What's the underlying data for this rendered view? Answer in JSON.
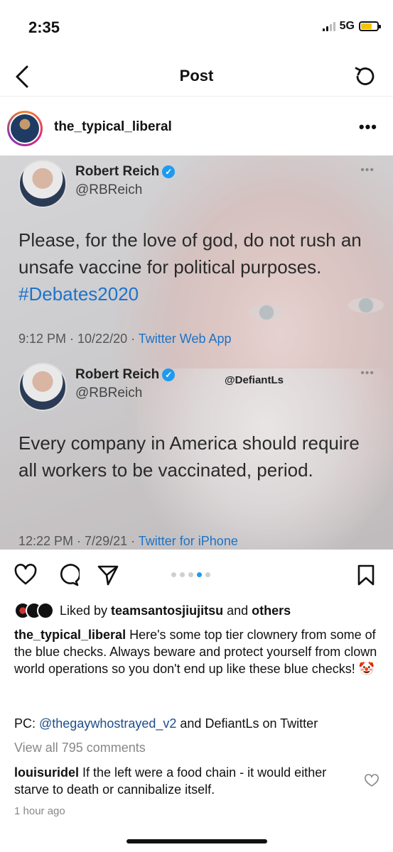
{
  "status": {
    "time": "2:35",
    "network": "5G"
  },
  "nav": {
    "title": "Post"
  },
  "post": {
    "username": "the_typical_liberal",
    "more": "•••"
  },
  "tweets": [
    {
      "name": "Robert Reich",
      "handle": "@RBReich",
      "text_main": "Please, for the love of god, do not rush an unsafe vaccine for political purposes. ",
      "hashtag": "#Debates2020",
      "meta_time": "9:12 PM · 10/22/20 · ",
      "meta_source": "Twitter Web App"
    },
    {
      "name": "Robert Reich",
      "handle": "@RBReich",
      "text_main": "Every company in America  should require all workers to be vaccinated, period.",
      "meta_time": "12:22 PM · 7/29/21 · ",
      "meta_source": "Twitter for iPhone"
    }
  ],
  "watermark": "@DefiantLs",
  "carousel": {
    "count": 5,
    "active_index": 3
  },
  "likes": {
    "prefix": "Liked by ",
    "user": "teamsantosjiujitsu",
    "middle": " and ",
    "others": "others"
  },
  "caption": {
    "username": "the_typical_liberal",
    "text": " Here's some top tier clownery from some of the blue checks. Always beware and protect yourself from clown world operations so you don't end up like these blue checks! 🤡"
  },
  "pc": {
    "prefix": "PC: ",
    "mention": "@thegaywhostrayed_v2",
    "suffix": " and DefiantLs on Twitter"
  },
  "view_all": "View all 795 comments",
  "comment": {
    "username": "louisuridel",
    "text": " If the left were a food chain - it would either starve to death or cannibalize itself."
  },
  "time_ago": "1 hour ago",
  "colors": {
    "verified": "#1d9bf0",
    "link": "#1d73c9",
    "mention": "#1c4e89"
  }
}
